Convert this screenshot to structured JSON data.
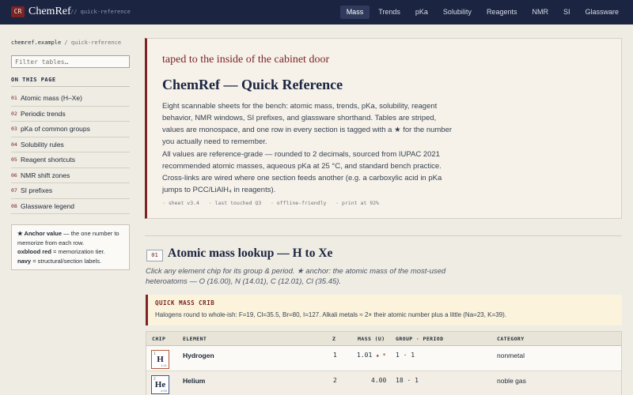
{
  "brand": {
    "badge": "CR",
    "name": "ChemRef",
    "subtitle": "// quick-reference"
  },
  "nav": [
    {
      "label": "Mass",
      "active": true
    },
    {
      "label": "Trends"
    },
    {
      "label": "pKa"
    },
    {
      "label": "Solubility"
    },
    {
      "label": "Reagents"
    },
    {
      "label": "NMR"
    },
    {
      "label": "SI"
    },
    {
      "label": "Glassware"
    }
  ],
  "sidebar": {
    "breadcrumb_host": "chemref.example",
    "breadcrumb_sep": " / ",
    "breadcrumb_page": "quick-reference",
    "filter_placeholder": "Filter tables…",
    "on_this_page": "ON THIS PAGE",
    "toc": [
      {
        "num": "01",
        "label": "Atomic mass (H–Xe)"
      },
      {
        "num": "02",
        "label": "Periodic trends"
      },
      {
        "num": "03",
        "label": "pKa of common groups"
      },
      {
        "num": "04",
        "label": "Solubility rules"
      },
      {
        "num": "05",
        "label": "Reagent shortcuts"
      },
      {
        "num": "06",
        "label": "NMR shift zones"
      },
      {
        "num": "07",
        "label": "SI prefixes"
      },
      {
        "num": "08",
        "label": "Glassware legend"
      }
    ],
    "legend": {
      "anchor_term": "★ Anchor value",
      "anchor_desc": " — the one number to memorize from each row.",
      "oxblood_term": "oxblood red",
      "oxblood_desc": " = memorization tier.",
      "navy_term": "navy",
      "navy_desc": " = structural/section labels."
    }
  },
  "intro": {
    "note": "taped to the inside of the cabinet door",
    "title": "ChemRef — Quick Reference",
    "p1": "Eight scannable sheets for the bench: atomic mass, trends, pKa, solubility, reagent behavior, NMR windows, SI prefixes, and glassware shorthand. Tables are striped, values are monospace, and one row in every section is tagged with a ★ for the number you actually need to remember.",
    "p2": "All values are reference-grade — rounded to 2 decimals, sourced from IUPAC 2021 recommended atomic masses, aqueous pKa at 25 °C, and standard bench practice. Cross-links are wired where one section feeds another (e.g. a carboxylic acid in pKa jumps to PCC/LiAlH₄ in reagents).",
    "meta": "· sheet v3.4   · last touched Q3   · offline-friendly   · print at 92%"
  },
  "section1": {
    "num": "01",
    "title": "Atomic mass lookup — H to Xe",
    "desc": "Click any element chip for its group & period. ★ anchor: the atomic mass of the most-used heteroatoms — O (16.00), N (14.01), C (12.01), Cl (35.45).",
    "crib_title": "QUICK MASS CRIB",
    "crib_text": "Halogens round to whole-ish: F=19, Cl=35.5, Br=80, I=127. Alkali metals ≈ 2× their atomic number plus a little (Na=23, K=39).",
    "columns": [
      "CHIP",
      "ELEMENT",
      "Z",
      "MASS (U)",
      "GROUP · PERIOD",
      "CATEGORY"
    ],
    "rows": [
      {
        "z": "1",
        "symbol": "H",
        "chip_mass": "1.01",
        "element": "Hydrogen",
        "mass": "1.01",
        "star": "★ *",
        "group_period": "1 · 1",
        "category": "nonmetal",
        "chip_color": "#b45a3c"
      },
      {
        "z": "2",
        "symbol": "He",
        "chip_mass": "4.00",
        "element": "Helium",
        "mass": "4.00",
        "star": "",
        "group_period": "18 · 1",
        "category": "noble gas",
        "chip_color": "#3b5b8a"
      }
    ]
  }
}
